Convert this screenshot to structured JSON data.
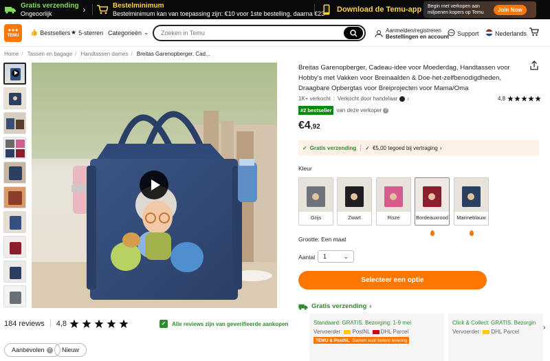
{
  "promo": {
    "free_ship_title": "Gratis verzending",
    "free_ship_sub": "Ongeoorlijk",
    "min_title": "Bestelminimum",
    "min_sub": "Bestelminimum kan van toepassing zijn: €10 voor 1ste bestelling, daarna €23",
    "app": "Download de Temu-app",
    "seller_text": "Begin met verkopen aan miljoenen kopers op Temu",
    "join": "Join Now"
  },
  "header": {
    "logo": "TEMU",
    "nav": [
      "Bestsellers",
      "5-sterren",
      "Categorieën"
    ],
    "search_placeholder": "Zoeken in Temu",
    "account_l1": "Aanmelden/registreren",
    "account_l2": "Bestellingen en account",
    "support": "Support",
    "language": "Nederlands"
  },
  "breadcrumb": [
    "Home",
    "Tassen en bagage",
    "Handtassen dames",
    "Breitas Garenopberger, Cad..."
  ],
  "product": {
    "title": "Breitas Garenopberger, Cadeau-idee voor Moederdag, Handtassen voor Hobby's met Vakken voor Breinaalden & Doe-het-zelfbenodigdheden, Draagbare Opbergtas voor Breiprojecten voor Mama/Oma",
    "sold": "1K+ verkocht",
    "seller": "Verkocht door handelaar",
    "rating": "4,8",
    "best_badge": "#2 bestseller",
    "best_text": "van deze verkoper",
    "price_main": "€4",
    "price_dec": ",92",
    "ship_free": "Gratis verzending",
    "ship_credit": "€5,00 tegoed bij vertraging",
    "color_label": "Kleur",
    "colors": [
      "Grijs",
      "Zwart",
      "Roze",
      "Bordeauxrood",
      "Marineblauw"
    ],
    "size": "Grootte: Een maat",
    "qty_label": "Aantal",
    "qty": "1",
    "cta": "Selecteer een optie",
    "free_shipping": "Gratis verzending"
  },
  "shipping_cards": [
    {
      "l1": "Standaard: GRATIS. Bezorging: 1-9 mei",
      "l2a": "Vervoerder:",
      "l2b": "PostNL",
      "l2c": "DHL Parcel",
      "strip": "Samen voor betere levering",
      "strip_logo": "TEMU & PostNL"
    },
    {
      "l1": "Click & Collect: GRATIS. Bezorgin",
      "l2a": "Vervoerder:",
      "l2b": "DHL Parcel"
    }
  ],
  "reviews": {
    "count": "184 reviews",
    "score": "4,8",
    "verified": "Alle reviews zijn van geverifieerde aankopen",
    "filters": [
      "Aanbevolen",
      "Nieuw"
    ]
  },
  "colors": {
    "accent": "#fb7701",
    "green": "#2e8b2e",
    "bag_blue": "#2f4f7f"
  }
}
